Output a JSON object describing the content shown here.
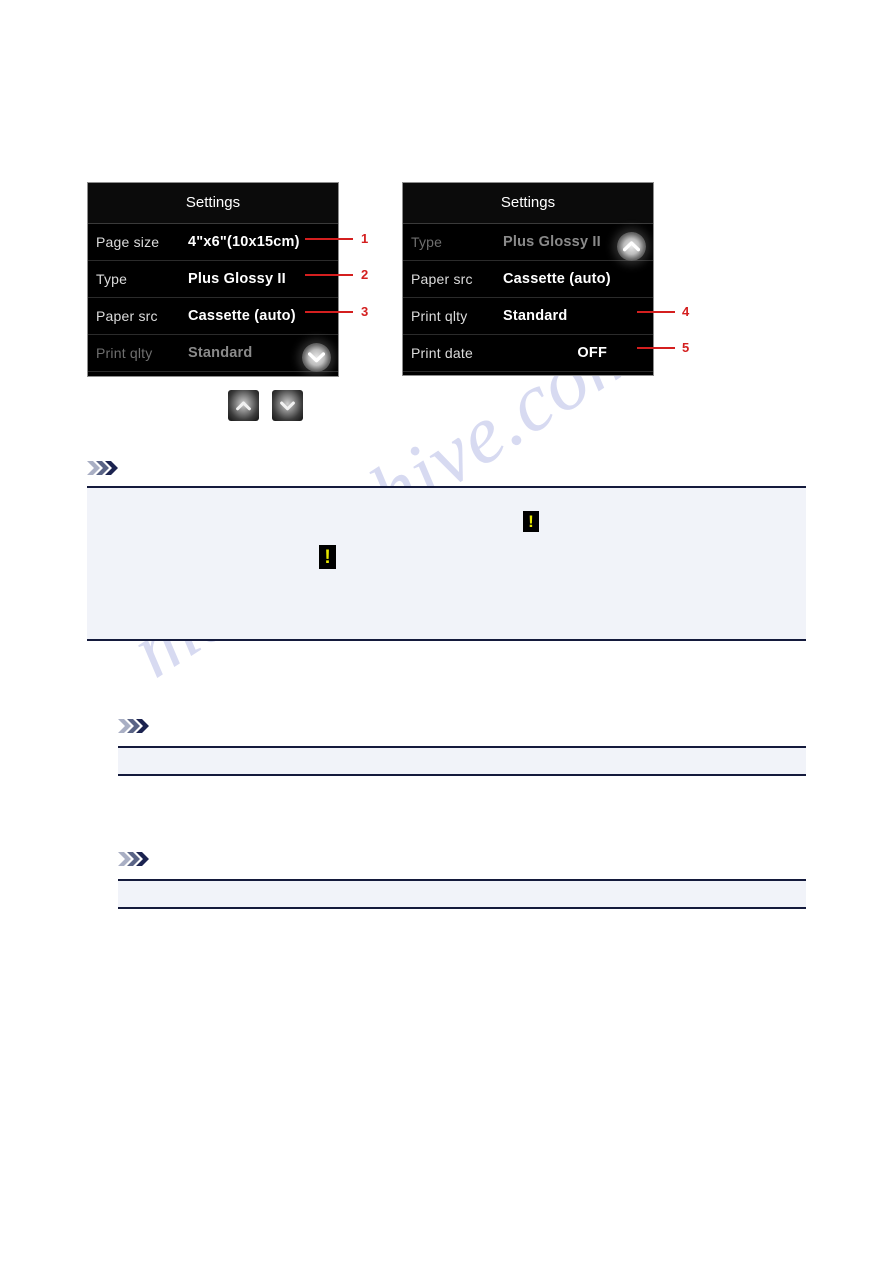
{
  "page": {
    "watermark_text": "manualshive.com"
  },
  "screens": [
    {
      "id": "settings-screen-1",
      "title": "Settings",
      "rows": [
        {
          "label": "Page size",
          "value": "4\"x6\"(10x15cm)",
          "dim": false,
          "value_align": "left"
        },
        {
          "label": "Type",
          "value": "Plus Glossy II",
          "dim": false,
          "value_align": "left"
        },
        {
          "label": "Paper src",
          "value": "Cassette (auto)",
          "dim": false,
          "value_align": "left"
        },
        {
          "label": "Print qlty",
          "value": "Standard",
          "dim": true,
          "value_align": "left"
        }
      ],
      "scroll_arrow": {
        "icon": "chevron-down-icon",
        "direction": "down"
      }
    },
    {
      "id": "settings-screen-2",
      "title": "Settings",
      "rows": [
        {
          "label": "Type",
          "value": "Plus Glossy II",
          "dim": true,
          "value_align": "left"
        },
        {
          "label": "Paper src",
          "value": "Cassette (auto)",
          "dim": false,
          "value_align": "left"
        },
        {
          "label": "Print qlty",
          "value": "Standard",
          "dim": false,
          "value_align": "left"
        },
        {
          "label": "Print date",
          "value": "OFF",
          "dim": false,
          "value_align": "right"
        }
      ],
      "scroll_arrow": {
        "icon": "chevron-up-icon",
        "direction": "up"
      }
    }
  ],
  "callouts": [
    {
      "number": "1",
      "target": "Page size"
    },
    {
      "number": "2",
      "target": "Type"
    },
    {
      "number": "3",
      "target": "Paper src"
    },
    {
      "number": "4",
      "target": "Print qlty"
    },
    {
      "number": "5",
      "target": "Print date"
    }
  ],
  "hardware_buttons": [
    {
      "name": "up-button",
      "icon": "chevron-up-icon"
    },
    {
      "name": "down-button",
      "icon": "chevron-down-icon"
    }
  ],
  "notes": [
    {
      "id": "note-1",
      "icon": "triple-chevron-icon",
      "warning_glyphs": [
        "!",
        "!"
      ]
    },
    {
      "id": "note-2",
      "icon": "triple-chevron-icon",
      "warning_glyphs": []
    },
    {
      "id": "note-3",
      "icon": "triple-chevron-icon",
      "warning_glyphs": []
    }
  ],
  "colors": {
    "callout_red": "#d41f1f",
    "note_border": "#141a3c",
    "note_fill": "#f1f3f9",
    "chevron_dark": "#1b2350",
    "chevron_mid": "#5a6486",
    "chevron_light": "#a9afc4",
    "warning_yellow": "#e8e800",
    "watermark": "#c8ccec"
  }
}
